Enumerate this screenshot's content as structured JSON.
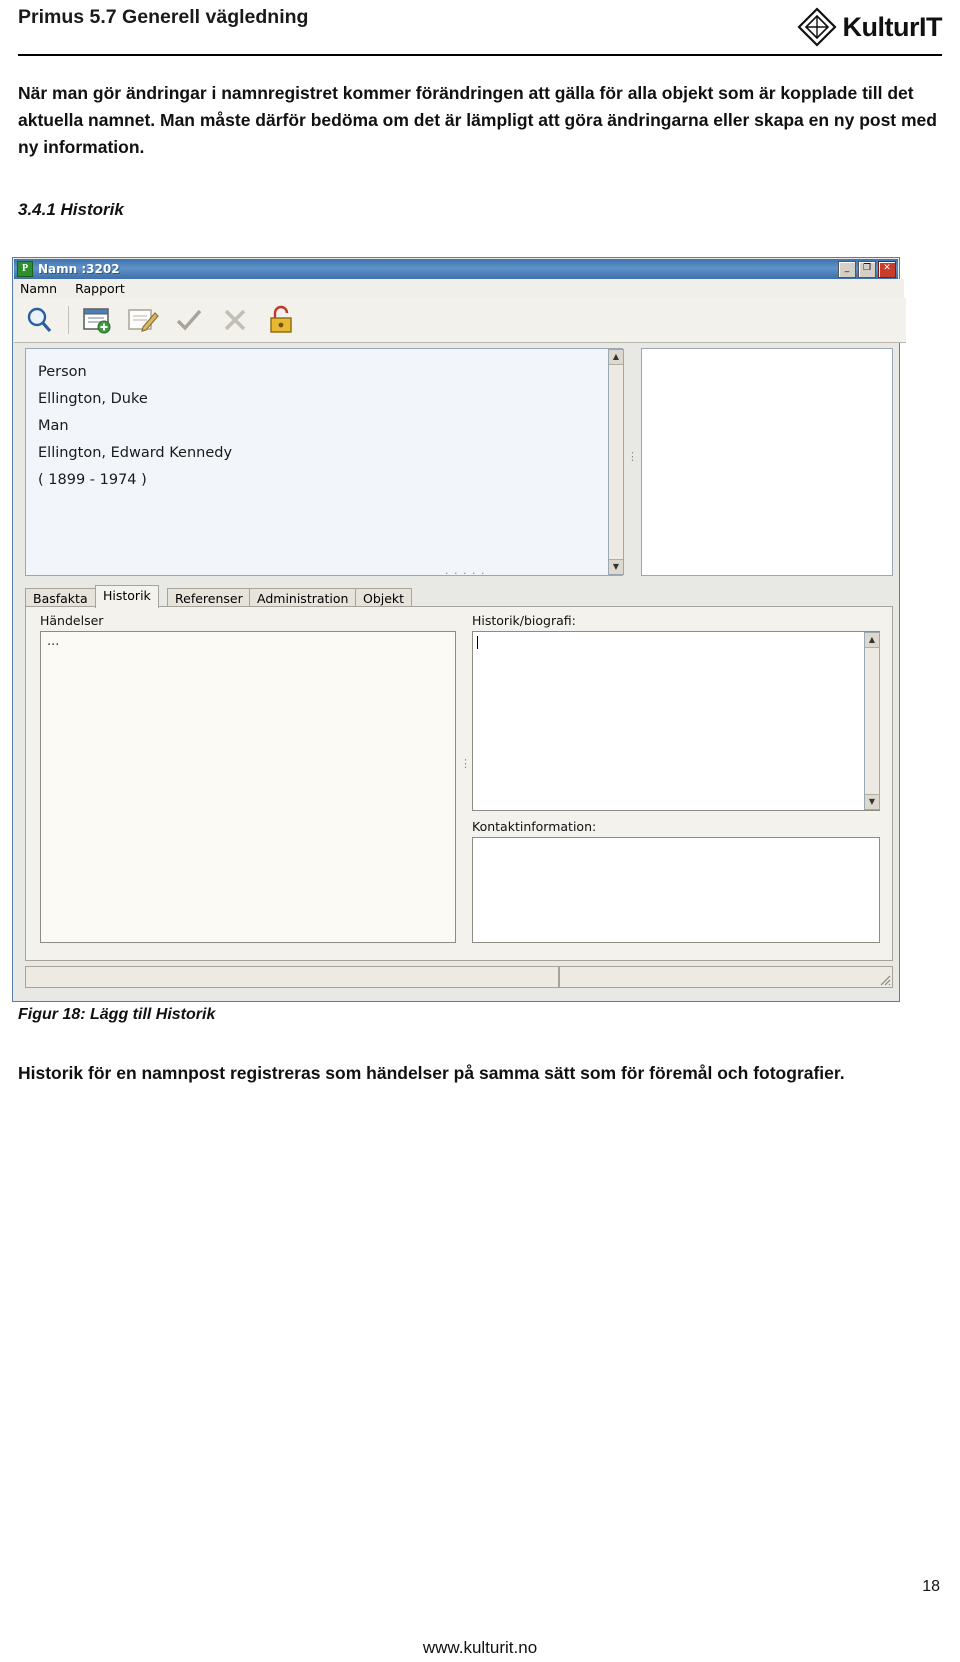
{
  "header": {
    "title": "Primus 5.7 Generell vägledning",
    "logo_text_1": "Kultur",
    "logo_text_2": "IT",
    "logo_icon": "diamond-logo-icon"
  },
  "body": {
    "paragraph_1": "När man gör ändringar i namnregistret kommer förändringen att gälla för alla objekt som är kopplade till det aktuella namnet. Man måste därför bedöma om det är lämpligt att göra ändringarna eller skapa en ny post med ny information.",
    "section_heading": "3.4.1 Historik",
    "figure_caption": "Figur 18: Lägg till Historik",
    "paragraph_2": "Historik för en namnpost registreras som händelser på samma sätt som för föremål och fotografier."
  },
  "footer": {
    "page_number": "18",
    "url": "www.kulturit.no"
  },
  "screenshot": {
    "window": {
      "title": "Namn :3202",
      "icon": "primus-p-icon",
      "buttons": [
        {
          "name": "minimize-button",
          "glyph": "_"
        },
        {
          "name": "maximize-button",
          "glyph": "❐"
        },
        {
          "name": "close-button",
          "glyph": "✕"
        }
      ]
    },
    "menu": [
      {
        "label": "Namn"
      },
      {
        "label": "Rapport"
      }
    ],
    "toolbar": [
      {
        "name": "search-icon",
        "label": "Sök"
      },
      {
        "name": "new-record-icon",
        "label": "Ny post"
      },
      {
        "name": "edit-icon",
        "label": "Redigera"
      },
      {
        "name": "confirm-check-icon",
        "label": "Bekräfta"
      },
      {
        "name": "cancel-x-icon",
        "label": "Avbryt"
      },
      {
        "name": "lock-icon",
        "label": "Lås"
      }
    ],
    "record": {
      "lines": [
        "Person",
        "Ellington, Duke",
        "Man",
        "Ellington, Edward Kennedy",
        "( 1899 - 1974 )"
      ]
    },
    "tabs": [
      {
        "label": "Basfakta",
        "active": false
      },
      {
        "label": "Historik",
        "active": true
      },
      {
        "label": "Referenser",
        "active": false
      },
      {
        "label": "Administration",
        "active": false
      },
      {
        "label": "Objekt",
        "active": false
      }
    ],
    "fields": [
      {
        "name": "handelser-label",
        "label": "Händelser",
        "value": "..."
      },
      {
        "name": "historik-biografi-label",
        "label": "Historik/biografi:",
        "value": ""
      },
      {
        "name": "kontaktinformation-label",
        "label": "Kontaktinformation:",
        "value": ""
      }
    ],
    "colors": {
      "titlebar": "#4a7fb5",
      "panel": "#f3f2ec",
      "record_panel": "#f2f6fb"
    }
  }
}
